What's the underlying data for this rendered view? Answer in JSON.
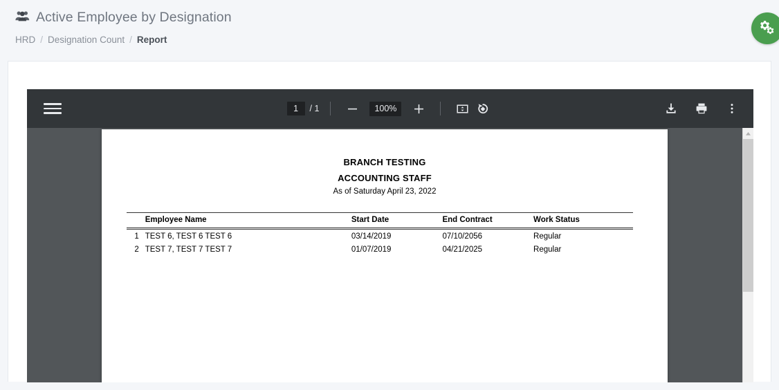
{
  "header": {
    "icon": "users-group-icon",
    "title": "Active Employee by Designation",
    "breadcrumb": [
      {
        "label": "HRD",
        "current": false
      },
      {
        "label": "Designation Count",
        "current": false
      },
      {
        "label": "Report",
        "current": true
      }
    ],
    "separator": "/"
  },
  "fab": {
    "icon": "gears-icon",
    "color": "#4a9e4f"
  },
  "pdf_toolbar": {
    "menu_icon": "hamburger-menu-icon",
    "page_number": "1",
    "page_total": "/ 1",
    "zoom_out_icon": "minus-icon",
    "zoom_level": "100%",
    "zoom_in_icon": "plus-icon",
    "fit_page_icon": "fit-to-page-icon",
    "rotate_icon": "rotate-counterclockwise-icon",
    "download_icon": "download-icon",
    "print_icon": "print-icon",
    "more_icon": "more-vertical-icon"
  },
  "document": {
    "title": "BRANCH TESTING",
    "subtitle": "ACCOUNTING STAFF",
    "as_of": "As of Saturday April 23, 2022",
    "columns": [
      "Employee Name",
      "Start Date",
      "End Contract",
      "Work Status"
    ],
    "rows": [
      {
        "index": "1",
        "name": "TEST 6, TEST 6 TEST 6",
        "start_date": "03/14/2019",
        "end_contract": "07/10/2056",
        "work_status": "Regular"
      },
      {
        "index": "2",
        "name": "TEST 7, TEST 7 TEST 7",
        "start_date": "01/07/2019",
        "end_contract": "04/21/2025",
        "work_status": "Regular"
      }
    ]
  }
}
